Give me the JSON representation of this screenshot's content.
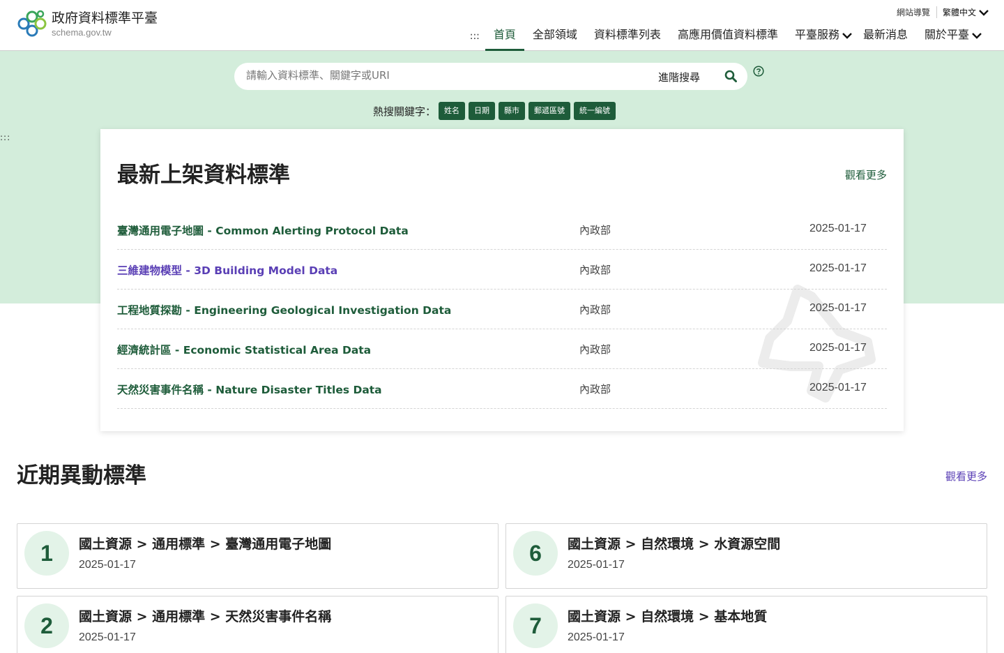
{
  "site": {
    "title": "政府資料標準平臺",
    "subtitle": "schema.gov.tw"
  },
  "utility": {
    "sitemap": "網站導覽",
    "language": "繁體中文"
  },
  "nav": {
    "accesskey": ":::",
    "items": [
      {
        "label": "首頁"
      },
      {
        "label": "全部領域"
      },
      {
        "label": "資料標準列表"
      },
      {
        "label": "高應用價值資料標準"
      },
      {
        "label": "平臺服務"
      },
      {
        "label": "最新消息"
      },
      {
        "label": "關於平臺"
      }
    ]
  },
  "accesskey_left": ":::",
  "search": {
    "placeholder": "請輸入資料標準、關鍵字或URI",
    "advanced": "進階搜尋"
  },
  "hot_keywords": {
    "label": "熱搜關鍵字：",
    "tags": [
      "姓名",
      "日期",
      "縣市",
      "郵遞區號",
      "統一編號"
    ]
  },
  "latest": {
    "title": "最新上架資料標準",
    "more": "觀看更多",
    "rows": [
      {
        "name": "臺灣通用電子地圖 - Common Alerting Protocol Data",
        "org": "內政部",
        "date": "2025-01-17"
      },
      {
        "name": "三維建物模型 - 3D Building Model Data",
        "org": "內政部",
        "date": "2025-01-17"
      },
      {
        "name": "工程地質探勘 - Engineering Geological Investigation Data",
        "org": "內政部",
        "date": "2025-01-17"
      },
      {
        "name": "經濟統計區 - Economic Statistical Area Data",
        "org": "內政部",
        "date": "2025-01-17"
      },
      {
        "name": "天然災害事件名稱 - Nature Disaster Titles Data",
        "org": "內政部",
        "date": "2025-01-17"
      }
    ]
  },
  "recent": {
    "title": "近期異動標準",
    "more": "觀看更多",
    "items": [
      {
        "num": "1",
        "path": "國土資源 > 通用標準 > 臺灣通用電子地圖",
        "date": "2025-01-17"
      },
      {
        "num": "6",
        "path": "國土資源 > 自然環境 > 水資源空間",
        "date": "2025-01-17"
      },
      {
        "num": "2",
        "path": "國土資源 > 通用標準 > 天然災害事件名稱",
        "date": "2025-01-17"
      },
      {
        "num": "7",
        "path": "國土資源 > 自然環境 > 基本地質",
        "date": "2025-01-17"
      }
    ]
  },
  "colors": {
    "brand_green": "#1e5c3a",
    "hero_bg": "#d3eddb",
    "visited_link": "#5a3fb5"
  }
}
